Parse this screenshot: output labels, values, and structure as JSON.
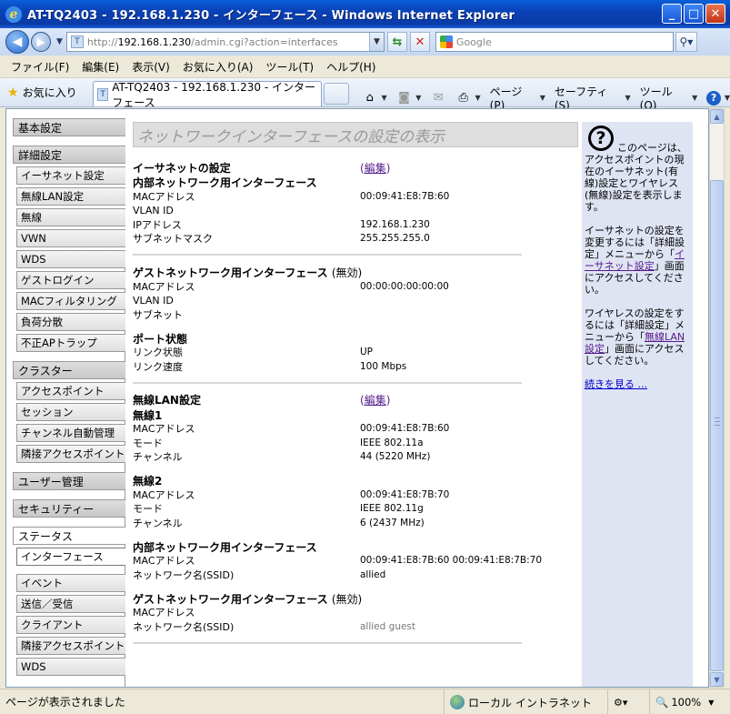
{
  "window": {
    "title": "AT-TQ2403 - 192.168.1.230 - インターフェース - Windows Internet Explorer"
  },
  "address": {
    "url_prefix": "http://",
    "url_host": "192.168.1.230",
    "url_path": "/admin.cgi?action=interfaces",
    "search_placeholder": "Google"
  },
  "menu": [
    "ファイル(F)",
    "編集(E)",
    "表示(V)",
    "お気に入り(A)",
    "ツール(T)",
    "ヘルプ(H)"
  ],
  "toolbar": {
    "favorites": "お気に入り",
    "tab_title": "AT-TQ2403 - 192.168.1.230 - インターフェース",
    "page_label": "ページ(P)",
    "safety_label": "セーフティ(S)",
    "tools_label": "ツール(O)"
  },
  "nav": {
    "basic": "基本設定",
    "advanced": "詳細設定",
    "advanced_items": [
      "イーサネット設定",
      "無線LAN設定",
      "無線",
      "VWN",
      "WDS",
      "ゲストログイン",
      "MACフィルタリング",
      "負荷分散",
      "不正APトラップ"
    ],
    "cluster": "クラスター",
    "cluster_items": [
      "アクセスポイント",
      "セッション",
      "チャンネル自動管理",
      "隣接アクセスポイント"
    ],
    "users": "ユーザー管理",
    "security": "セキュリティー",
    "status": "ステータス",
    "status_items": [
      "インターフェース",
      "イベント",
      "送信／受信",
      "クライアント",
      "隣接アクセスポイント",
      "WDS"
    ]
  },
  "main": {
    "page_title": "ネットワークインターフェースの設定の表示",
    "edit_open": "(",
    "edit_label": "編集",
    "edit_close": ")",
    "ethernet": {
      "title": "イーサネットの設定",
      "internal_title": "内部ネットワーク用インターフェース",
      "rows": [
        {
          "k": "MACアドレス",
          "v": "00:09:41:E8:7B:60"
        },
        {
          "k": "VLAN ID",
          "v": ""
        },
        {
          "k": "IPアドレス",
          "v": "192.168.1.230"
        },
        {
          "k": "サブネットマスク",
          "v": "255.255.255.0"
        }
      ]
    },
    "guest": {
      "title": "ゲストネットワーク用インターフェース",
      "suffix": "(無効)",
      "rows": [
        {
          "k": "MACアドレス",
          "v": "00:00:00:00:00:00"
        },
        {
          "k": "VLAN ID",
          "v": ""
        },
        {
          "k": "サブネット",
          "v": ""
        }
      ]
    },
    "port": {
      "title": "ポート状態",
      "rows": [
        {
          "k": "リンク状態",
          "v": "UP"
        },
        {
          "k": "リンク速度",
          "v": "100 Mbps"
        }
      ]
    },
    "wireless": {
      "title": "無線LAN設定",
      "radio1_title": "無線1",
      "radio1_rows": [
        {
          "k": "MACアドレス",
          "v": "00:09:41:E8:7B:60"
        },
        {
          "k": "モード",
          "v": "IEEE 802.11a"
        },
        {
          "k": "チャンネル",
          "v": "44 (5220 MHz)"
        }
      ],
      "radio2_title": "無線2",
      "radio2_rows": [
        {
          "k": "MACアドレス",
          "v": "00:09:41:E8:7B:70"
        },
        {
          "k": "モード",
          "v": "IEEE 802.11g"
        },
        {
          "k": "チャンネル",
          "v": "6 (2437 MHz)"
        }
      ],
      "internal_title": "内部ネットワーク用インターフェース",
      "internal_rows": [
        {
          "k": "MACアドレス",
          "v": "00:09:41:E8:7B:60 00:09:41:E8:7B:70"
        },
        {
          "k": "ネットワーク名(SSID)",
          "v": "allied"
        }
      ],
      "guest_title": "ゲストネットワーク用インターフェース",
      "guest_suffix": "(無効)",
      "guest_rows": [
        {
          "k": "MACアドレス",
          "v": ""
        },
        {
          "k": "ネットワーク名(SSID)",
          "v": "allied guest"
        }
      ]
    }
  },
  "help": {
    "p1": "このページは、アクセスポイントの現在のイーサネット(有線)設定とワイヤレス(無線)設定を表示します。",
    "p2_a": "イーサネットの設定を変更するには「詳細設定」メニューから「",
    "p2_link": "イーサネット設定",
    "p2_b": "」画面にアクセスしてください。",
    "p3_a": "ワイヤレスの設定をするには「詳細設定」メニューから「",
    "p3_link": "無線LAN設定",
    "p3_b": "」画面にアクセスしてください。",
    "more": "続きを見る ..."
  },
  "status": {
    "message": "ページが表示されました",
    "zone": "ローカル イントラネット",
    "zoom": "100%"
  }
}
